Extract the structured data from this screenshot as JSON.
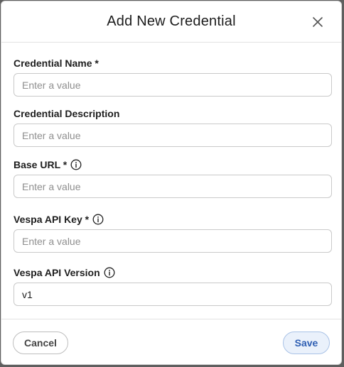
{
  "dialog": {
    "title": "Add New Credential",
    "close_icon": "close-icon"
  },
  "fields": [
    {
      "label": "Credential Name *",
      "info": false,
      "value": "",
      "placeholder": "Enter a value"
    },
    {
      "label": "Credential Description",
      "info": false,
      "value": "",
      "placeholder": "Enter a value"
    },
    {
      "label": "Base URL *",
      "info": true,
      "value": "",
      "placeholder": "Enter a value"
    },
    {
      "label": "Vespa API Key *",
      "info": true,
      "value": "",
      "placeholder": "Enter a value"
    },
    {
      "label": "Vespa API Version",
      "info": true,
      "value": "v1",
      "placeholder": "Enter a value"
    }
  ],
  "footer": {
    "cancel_label": "Cancel",
    "save_label": "Save"
  },
  "colors": {
    "save_accent": "#2f5fb3",
    "save_background": "#eaf1fb"
  }
}
